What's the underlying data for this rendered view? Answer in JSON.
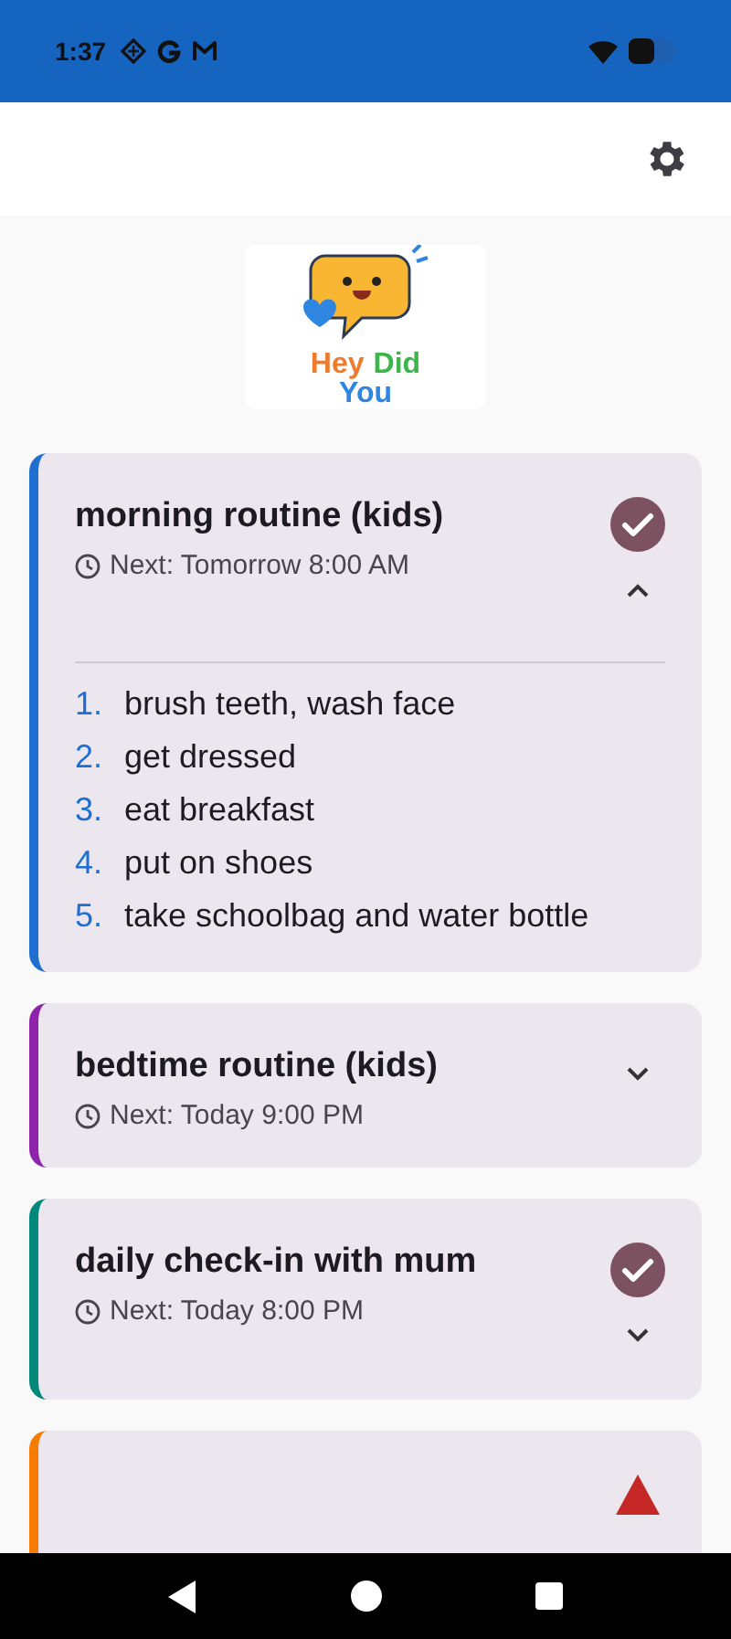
{
  "status_bar": {
    "time": "1:37"
  },
  "logo": {
    "words": [
      {
        "text": "Hey",
        "color": "#f07a2c"
      },
      {
        "text": "Did",
        "color": "#3cb54a"
      },
      {
        "text": "You",
        "color": "#2f86e0"
      }
    ]
  },
  "routines": [
    {
      "title": "morning routine (kids)",
      "next": "Next: Tomorrow 8:00 AM",
      "color": "#1e6fd0",
      "done": true,
      "expanded": true,
      "steps": [
        {
          "number": "1.",
          "text": "brush teeth, wash face"
        },
        {
          "number": "2.",
          "text": "get dressed"
        },
        {
          "number": "3.",
          "text": "eat breakfast"
        },
        {
          "number": "4.",
          "text": "put on shoes"
        },
        {
          "number": "5.",
          "text": "take schoolbag and water bottle"
        }
      ]
    },
    {
      "title": "bedtime routine (kids)",
      "next": "Next: Today 9:00 PM",
      "color": "#8e24aa",
      "done": false,
      "expanded": false
    },
    {
      "title": "daily check-in with mum",
      "next": "Next: Today 8:00 PM",
      "color": "#00897b",
      "done": true,
      "expanded": false
    },
    {
      "color": "#f57c00",
      "warning": true
    }
  ]
}
